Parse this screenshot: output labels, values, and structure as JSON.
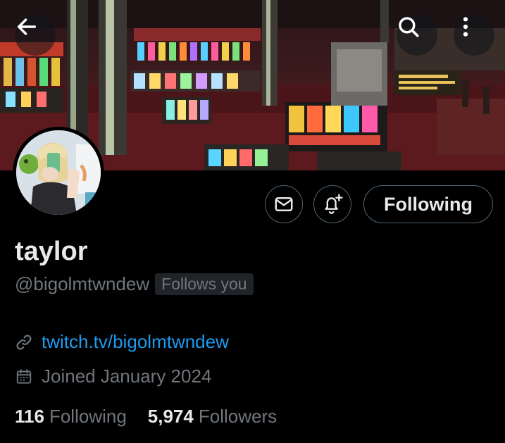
{
  "profile": {
    "name": "taylor",
    "handle": "@bigolmtwndew",
    "follows_you_badge": "Follows you",
    "link": "twitch.tv/bigolmtwndew",
    "joined": "Joined January 2024"
  },
  "actions": {
    "following_label": "Following"
  },
  "stats": {
    "following_count": "116",
    "following_label": "Following",
    "followers_count": "5,974",
    "followers_label": "Followers"
  },
  "colors": {
    "background": "#000000",
    "text_primary": "#e7e9ea",
    "text_secondary": "#71767b",
    "link": "#1d9bf0",
    "button_border": "#536471"
  },
  "icons": {
    "header": [
      "back-arrow-icon",
      "search-icon",
      "more-vertical-icon"
    ],
    "actions": [
      "mail-icon",
      "bell-plus-icon"
    ],
    "details": [
      "link-icon",
      "calendar-icon"
    ]
  }
}
